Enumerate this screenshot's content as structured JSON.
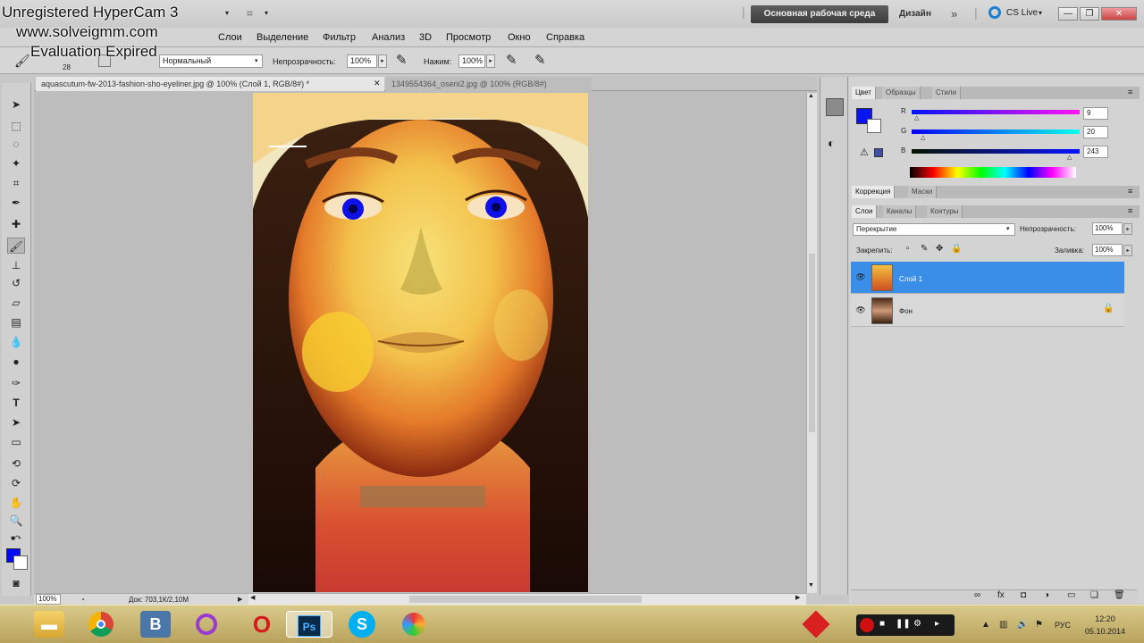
{
  "watermark": {
    "line1": "Unregistered HyperCam 3",
    "line2": "www.solveigmm.com",
    "line3": "Evaluation Expired"
  },
  "menu": {
    "items": [
      "Слои",
      "Выделение",
      "Фильтр",
      "Анализ",
      "3D",
      "Просмотр",
      "Окно",
      "Справка"
    ]
  },
  "titlebar": {
    "workspace": "Основная рабочая среда",
    "design": "Дизайн",
    "cslive": "CS Live"
  },
  "options": {
    "brush_size": "28",
    "mode_value": "Нормальный",
    "opacity_label": "Непрозрачность:",
    "opacity_value": "100%",
    "pressure_label": "Нажим:",
    "pressure_value": "100%"
  },
  "documents": {
    "tab1": "aquascutum-fw-2013-fashion-sho-eyeliner.jpg @ 100% (Слой 1, RGB/8#) *",
    "tab2": "1349554364_oseni2.jpg @ 100% (RGB/8#)",
    "zoom": "100%",
    "doc_size": "Док: 703,1К/2,10М"
  },
  "color_panel": {
    "tabs": [
      "Цвет",
      "Образцы",
      "Стили"
    ],
    "r_label": "R",
    "g_label": "G",
    "b_label": "B",
    "r": "9",
    "g": "20",
    "b": "243",
    "fg_color": "#0914f3"
  },
  "adjust_panel": {
    "tabs": [
      "Коррекция",
      "Маски"
    ]
  },
  "layers_panel": {
    "tabs": [
      "Слои",
      "Каналы",
      "Контуры"
    ],
    "blend_mode": "Перекрытие",
    "opacity_label": "Непрозрачность:",
    "opacity_value": "100%",
    "lock_label": "Закрепить:",
    "fill_label": "Заливка:",
    "fill_value": "100%",
    "layers": [
      {
        "name": "Слой 1",
        "selected": true
      },
      {
        "name": "Фон",
        "selected": false
      }
    ]
  },
  "taskbar": {
    "icons": [
      "folder-icon",
      "chrome-icon",
      "vk-icon",
      "circle-app-icon",
      "opera-icon",
      "photoshop-icon",
      "skype-icon",
      "ball-app-icon"
    ],
    "time": "12:20",
    "date": "05.10.2014",
    "lang": "РУС",
    "vk_letter": "B",
    "ps_letters": "Ps",
    "skype_letter": "S"
  }
}
